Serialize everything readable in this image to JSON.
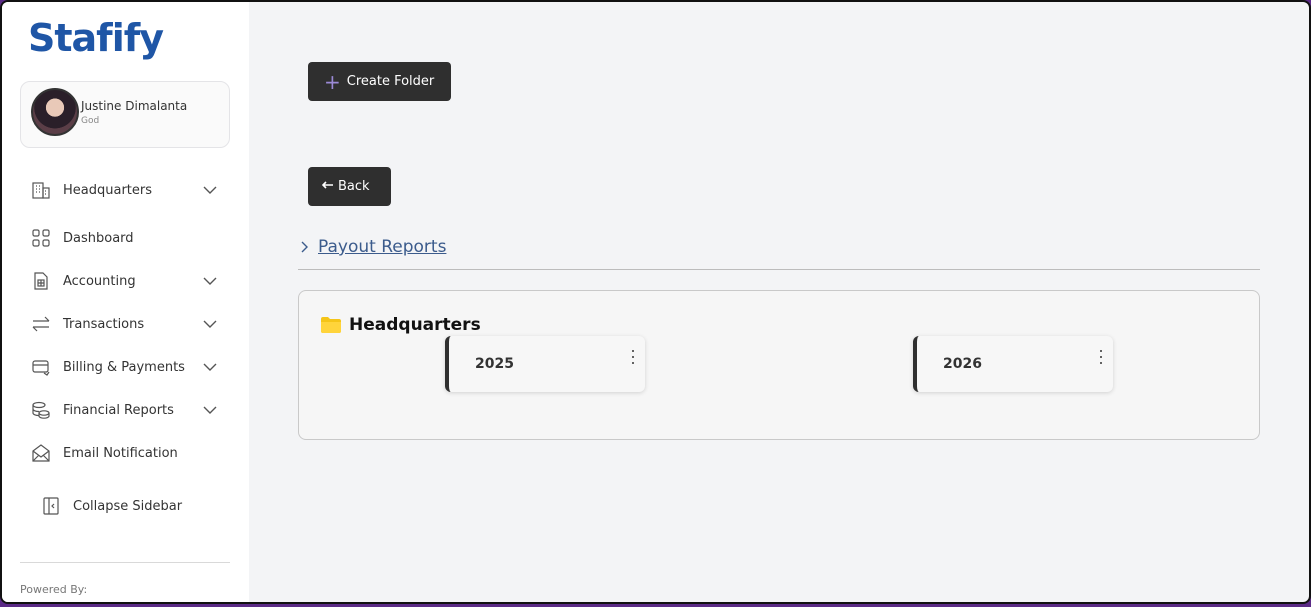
{
  "app": {
    "logo_text": "Stafify",
    "brand_color": "#1f56a6"
  },
  "profile": {
    "name": "Justine Dimalanta",
    "role": "God"
  },
  "sidebar": {
    "items": [
      {
        "label": "Headquarters",
        "icon": "building-icon",
        "has_chevron": true
      },
      {
        "label": "Dashboard",
        "icon": "grid-icon",
        "has_chevron": false
      },
      {
        "label": "Accounting",
        "icon": "calculator-doc-icon",
        "has_chevron": true
      },
      {
        "label": "Transactions",
        "icon": "swap-arrows-icon",
        "has_chevron": true
      },
      {
        "label": "Billing & Payments",
        "icon": "card-icon",
        "has_chevron": true
      },
      {
        "label": "Financial Reports",
        "icon": "coins-icon",
        "has_chevron": true
      },
      {
        "label": "Email Notification",
        "icon": "envelope-icon",
        "has_chevron": false
      }
    ],
    "collapse_label": "Collapse Sidebar",
    "powered_by": "Powered By:"
  },
  "main": {
    "create_folder_label": "Create Folder",
    "back_label": "Back",
    "breadcrumb_link": "Payout Reports",
    "folder_section": {
      "title": "Headquarters",
      "folder_color": "#f5c518",
      "cards": [
        {
          "label": "2025"
        },
        {
          "label": "2026"
        }
      ]
    }
  }
}
